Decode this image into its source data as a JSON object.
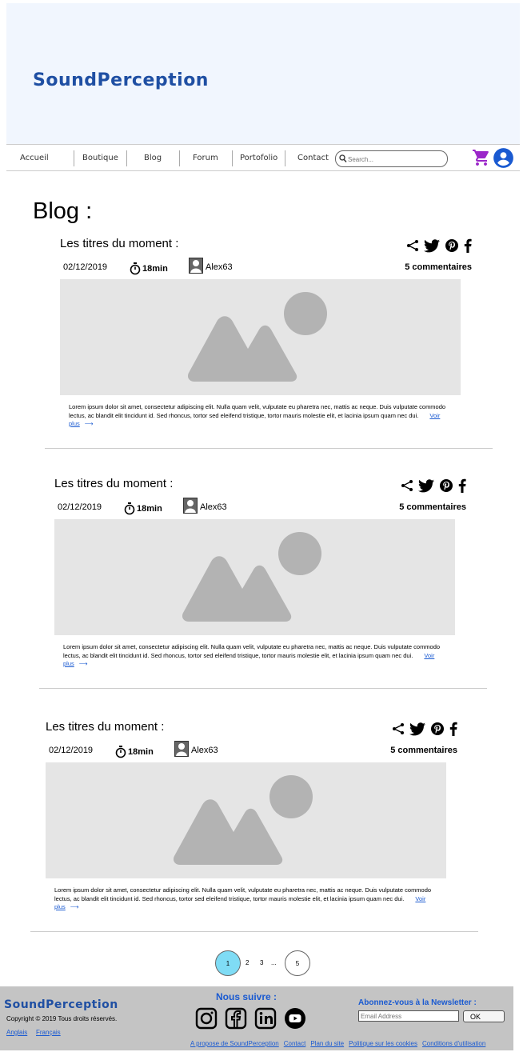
{
  "header": {
    "brand": "SoundPerception"
  },
  "nav": {
    "items": [
      "Accueil",
      "Boutique",
      "Blog",
      "Forum",
      "Portofolio",
      "Contact"
    ],
    "search_placeholder": "Search..."
  },
  "page_title": "Blog :",
  "posts": [
    {
      "heading": "Les titres du moment :",
      "date": "02/12/2019",
      "duration": "18min",
      "author": "Alex63",
      "comments": "5 commentaires",
      "excerpt": "Lorem ipsum dolor sit amet, consectetur adipiscing elit. Nulla quam velit, vulputate eu pharetra nec, mattis ac neque. Duis vulputate commodo lectus, ac blandit elit tincidunt id. Sed rhoncus, tortor sed eleifend tristique, tortor mauris molestie elit, et lacinia ipsum quam nec dui.",
      "read_more": "Voir plus"
    },
    {
      "heading": "Les titres du moment :",
      "date": "02/12/2019",
      "duration": "18min",
      "author": "Alex63",
      "comments": "5 commentaires",
      "excerpt": "Lorem ipsum dolor sit amet, consectetur adipiscing elit. Nulla quam velit, vulputate eu pharetra nec, mattis ac neque. Duis vulputate commodo lectus, ac blandit elit tincidunt id. Sed rhoncus, tortor sed eleifend tristique, tortor mauris molestie elit, et lacinia ipsum quam nec dui.",
      "read_more": "Voir plus"
    },
    {
      "heading": "Les titres du moment :",
      "date": "02/12/2019",
      "duration": "18min",
      "author": "Alex63",
      "comments": "5 commentaires",
      "excerpt": "Lorem ipsum dolor sit amet, consectetur adipiscing elit. Nulla quam velit, vulputate eu pharetra nec, mattis ac neque. Duis vulputate commodo lectus, ac blandit elit tincidunt id. Sed rhoncus, tortor sed eleifend tristique, tortor mauris molestie elit, et lacinia ipsum quam nec dui.",
      "read_more": "Voir plus"
    }
  ],
  "pagination": {
    "current": "1",
    "pages": [
      "2",
      "3"
    ],
    "ellipsis": "...",
    "last": "5",
    "active_color": "#7fdcf5"
  },
  "footer": {
    "brand": "SoundPerception",
    "copyright": "Copyright © 2019 Tous droits réservés.",
    "languages": [
      "Anglais",
      "Français"
    ],
    "follow_title": "Nous suivre :",
    "social_icons": [
      "instagram-icon",
      "facebook-icon",
      "linkedin-icon",
      "youtube-icon"
    ],
    "newsletter_title": "Abonnez-vous à la Newsletter :",
    "email_placeholder": "Email Address",
    "ok_label": "OK",
    "links": [
      "A propose de SoundPerception",
      "Contact",
      "Plan du site",
      "Politique sur les cookies",
      "Conditions d'utilisation"
    ]
  },
  "colors": {
    "brand": "#1f4fa3",
    "link": "#1a5ad1",
    "header_bg": "#f1f6fe",
    "footer_bg": "#c4c4c4",
    "cart": "#9b27c9",
    "user": "#1a5ad1"
  }
}
